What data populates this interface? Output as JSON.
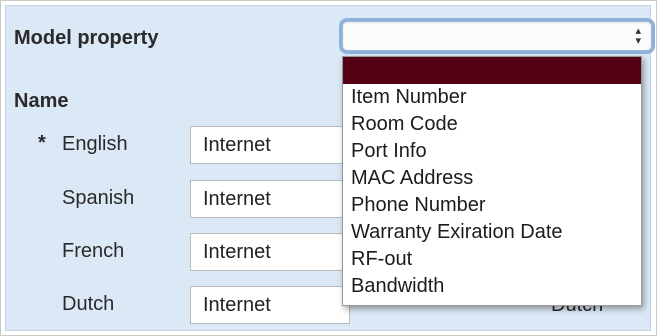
{
  "form": {
    "model_property_label": "Model property",
    "name_label": "Name",
    "required_marker": "*",
    "rows": [
      {
        "language": "English",
        "value": "Internet"
      },
      {
        "language": "Spanish",
        "value": "Internet"
      },
      {
        "language": "French",
        "value": "Internet"
      },
      {
        "language": "Dutch",
        "value": "Internet"
      }
    ],
    "right_column_dutch": "Dutch"
  },
  "select": {
    "selected_value": "",
    "arrow_up": "▴",
    "arrow_down": "▾",
    "options": [
      "",
      "Item Number",
      "Room Code",
      "Port Info",
      "MAC Address",
      "Phone Number",
      "Warranty Exiration Date",
      "RF-out",
      "Bandwidth"
    ]
  },
  "colors": {
    "panel_bg": "#dbe8f5",
    "selected_option_bg": "#560016",
    "focus_ring": "#8db2dc"
  }
}
